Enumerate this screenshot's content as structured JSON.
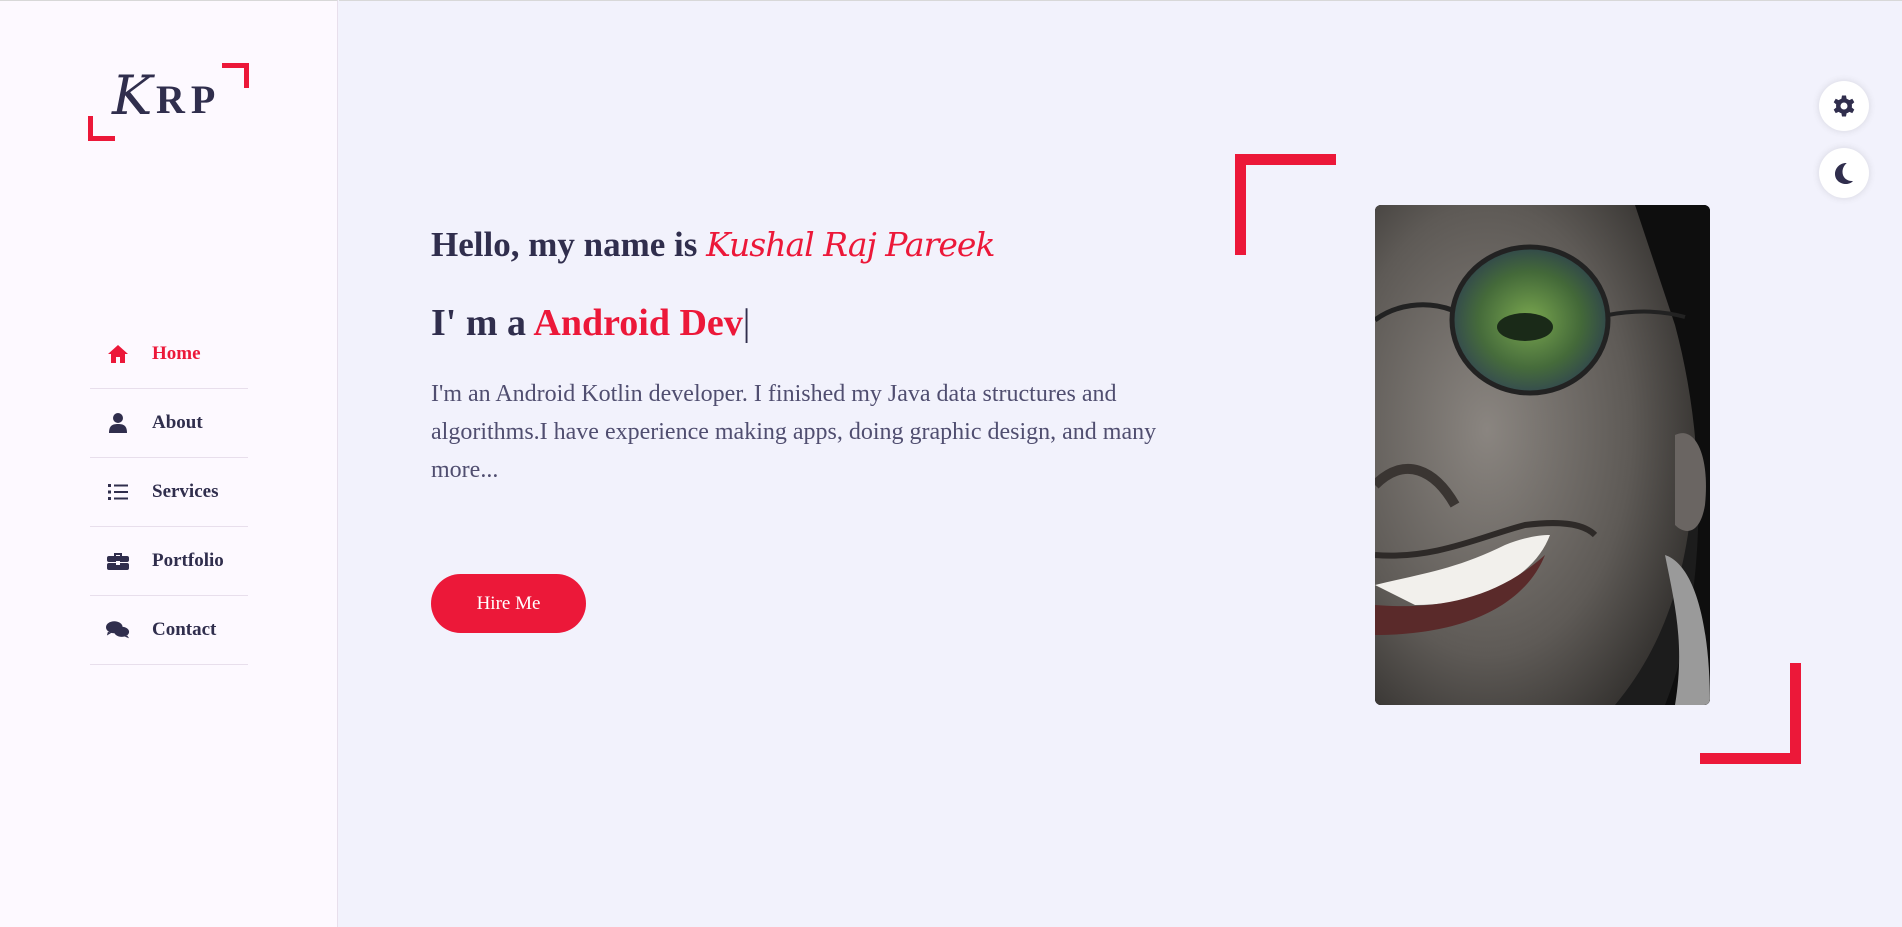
{
  "logo": {
    "first": "K",
    "rest": "RP"
  },
  "nav": {
    "items": [
      {
        "label": "Home",
        "icon": "home-icon",
        "active": true
      },
      {
        "label": "About",
        "icon": "user-icon",
        "active": false
      },
      {
        "label": "Services",
        "icon": "list-icon",
        "active": false
      },
      {
        "label": "Portfolio",
        "icon": "briefcase-icon",
        "active": false
      },
      {
        "label": "Contact",
        "icon": "comments-icon",
        "active": false
      }
    ]
  },
  "hero": {
    "greeting": "Hello, my name is",
    "name": "Kushal Raj Pareek",
    "role_prefix": "I' m a",
    "role_typed": "Android Dev",
    "cursor": "|",
    "description": "I'm an Android Kotlin developer. I finished my Java data structures and algorithms.I have experience making apps, doing graphic design, and many more...",
    "hire_button": "Hire Me"
  },
  "controls": {
    "settings_icon": "gear-icon",
    "theme_icon": "moon-icon"
  },
  "colors": {
    "accent": "#ec1839",
    "text_dark": "#302e4d",
    "text_muted": "#504e70",
    "bg_main": "#f2f2fc",
    "bg_sidebar": "#fdf9ff"
  }
}
